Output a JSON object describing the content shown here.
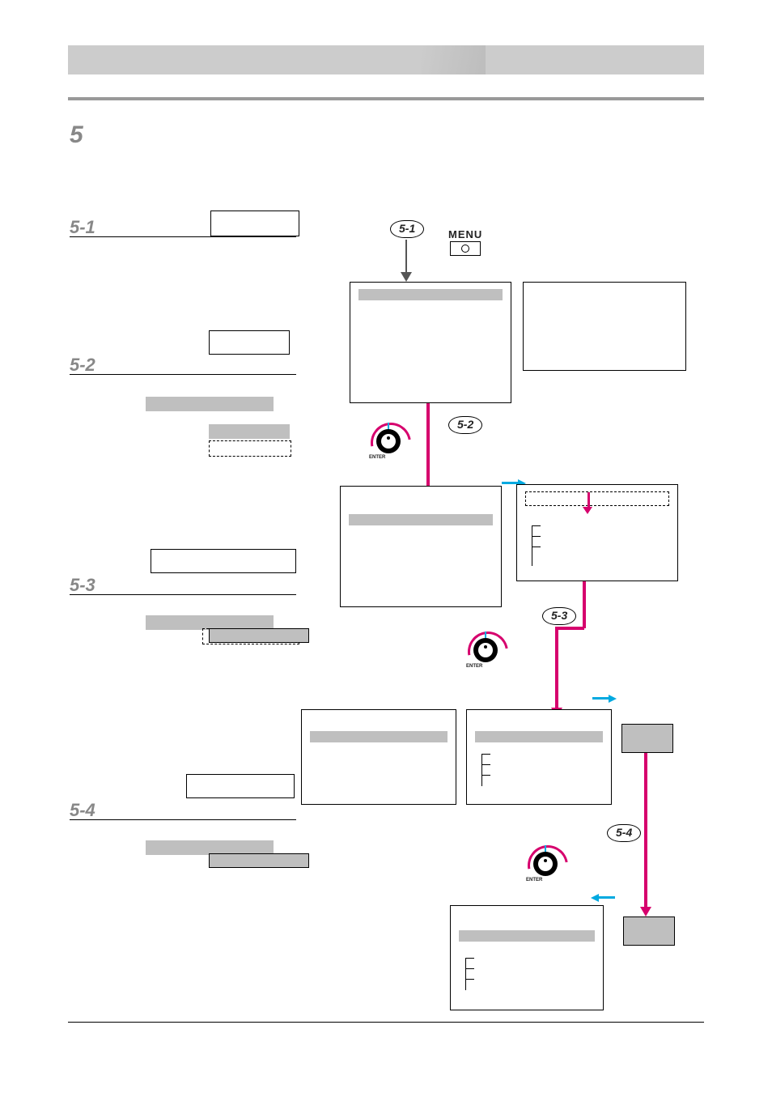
{
  "header": {
    "band_color": "#cccccc"
  },
  "section_number": "5",
  "left": {
    "s51": {
      "num": "5-1"
    },
    "s52": {
      "num": "5-2"
    },
    "s53": {
      "num": "5-3"
    },
    "s54": {
      "num": "5-4"
    }
  },
  "flow": {
    "p51": "5-1",
    "p52": "5-2",
    "p53": "5-3",
    "p54": "5-4",
    "menu_label": "MENU",
    "enter_label": "ENTER"
  }
}
